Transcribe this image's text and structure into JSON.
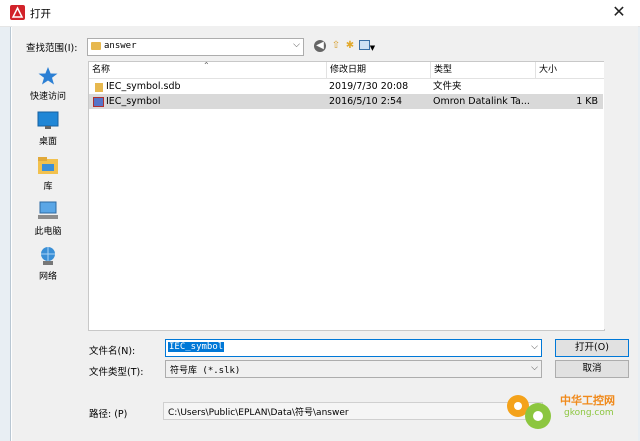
{
  "window": {
    "title": "打开"
  },
  "lookin": {
    "label": "查找范围(I):",
    "value": "answer"
  },
  "places": [
    {
      "label": "快速访问",
      "icon": "star-icon"
    },
    {
      "label": "桌面",
      "icon": "desktop-icon"
    },
    {
      "label": "库",
      "icon": "library-icon"
    },
    {
      "label": "此电脑",
      "icon": "computer-icon"
    },
    {
      "label": "网络",
      "icon": "network-icon"
    }
  ],
  "columns": [
    "名称",
    "修改日期",
    "类型",
    "大小"
  ],
  "files": [
    {
      "name": "IEC_symbol.sdb",
      "modified": "2019/7/30 20:08",
      "type": "文件夹",
      "size": "",
      "icon": "folder-icon",
      "selected": false
    },
    {
      "name": "IEC_symbol",
      "modified": "2016/5/10 2:54",
      "type": "Omron Datalink Ta...",
      "size": "1 KB",
      "icon": "symbol-file-icon",
      "selected": true
    }
  ],
  "filename": {
    "label": "文件名(N):",
    "value": "IEC_symbol"
  },
  "filetype": {
    "label": "文件类型(T):",
    "value": "符号库 (*.slk)"
  },
  "path": {
    "label": "路径: (P)",
    "value": "C:\\Users\\Public\\EPLAN\\Data\\符号\\answer"
  },
  "buttons": {
    "open": "打开(O)",
    "cancel": "取消"
  },
  "watermark": {
    "text": "中华工控网",
    "sub": "gkong.com"
  }
}
